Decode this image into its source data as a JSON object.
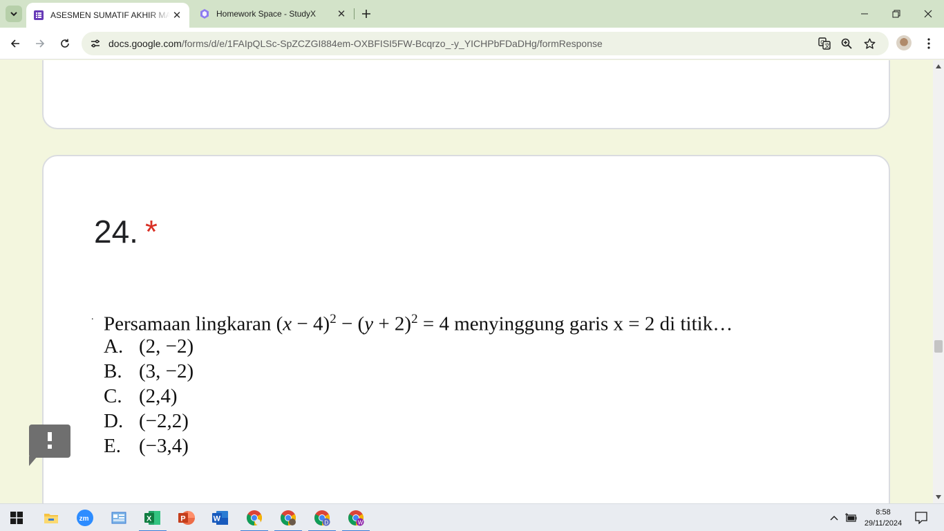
{
  "browser": {
    "tabs": [
      {
        "title": "ASESMEN SUMATIF AKHIR MAT",
        "active": true
      },
      {
        "title": "Homework Space - StudyX",
        "active": false
      }
    ],
    "url_host": "docs.google.com",
    "url_path": "/forms/d/e/1FAIpQLSc-SpZCZGI884em-OXBFISI5FW-Bcqrzo_-y_YICHPbFDaDHg/formResponse",
    "window_controls": [
      "minimize-icon",
      "restore-icon",
      "close-icon"
    ]
  },
  "question": {
    "number": "24.",
    "required_mark": "*",
    "image_text": {
      "bullet": ".",
      "stem_start": "Persamaan lingkaran (",
      "x_var": "x",
      "part_a": " − 4)",
      "exp1": "2",
      "part_b": " − (",
      "y_var": "y",
      "part_c": " + 2)",
      "exp2": "2",
      "stem_end": " = 4 menyinggung garis x = 2 di titik…",
      "options": [
        {
          "letter": "A.",
          "value": "(2, −2)"
        },
        {
          "letter": "B.",
          "value": "(3, −2)"
        },
        {
          "letter": "C.",
          "value": "(2,4)"
        },
        {
          "letter": "D.",
          "value": "(−2,2)"
        },
        {
          "letter": "E.",
          "value": "(−3,4)"
        }
      ]
    }
  },
  "taskbar": {
    "apps": [
      "windows-start",
      "file-explorer",
      "zoom",
      "control-panel",
      "excel",
      "powerpoint",
      "word",
      "chrome",
      "chrome-profile-2",
      "chrome-profile-d",
      "chrome-profile-w"
    ],
    "time": "8:58",
    "date": "29/11/2024"
  },
  "colors": {
    "tab_strip": "#d3e3c9",
    "page_bg": "#f3f6de",
    "required": "#d93025",
    "taskbar_accent": "#3a7bd5"
  }
}
